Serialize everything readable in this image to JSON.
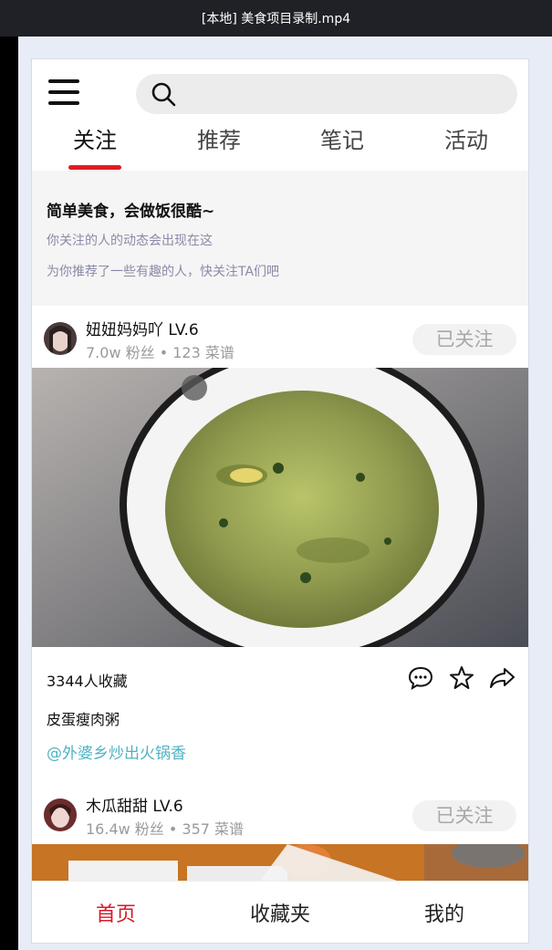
{
  "window": {
    "title": "[本地] 美食项目录制.mp4"
  },
  "header": {
    "tabs": [
      {
        "label": "关注",
        "active": true
      },
      {
        "label": "推荐",
        "active": false
      },
      {
        "label": "笔记",
        "active": false
      },
      {
        "label": "活动",
        "active": false
      }
    ]
  },
  "notice": {
    "title": "简单美食，会做饭很酷~",
    "line1": "你关注的人的动态会出现在这",
    "line2": "为你推荐了一些有趣的人，快关注TA们吧"
  },
  "posts": [
    {
      "user": "妞妞妈妈吖 LV.6",
      "stats": "7.0w 粉丝 • 123 菜谱",
      "follow_label": "已关注",
      "collect": "3344人收藏",
      "title": "皮蛋瘦肉粥",
      "tag": "@外婆乡炒出火锅香"
    },
    {
      "user": "木瓜甜甜 LV.6",
      "stats": "16.4w 粉丝 • 357 菜谱",
      "follow_label": "已关注"
    }
  ],
  "bottom_nav": [
    {
      "label": "首页",
      "active": true
    },
    {
      "label": "收藏夹",
      "active": false
    },
    {
      "label": "我的",
      "active": false
    }
  ],
  "colors": {
    "accent": "#e01b24",
    "tag": "#4fb3c2"
  }
}
